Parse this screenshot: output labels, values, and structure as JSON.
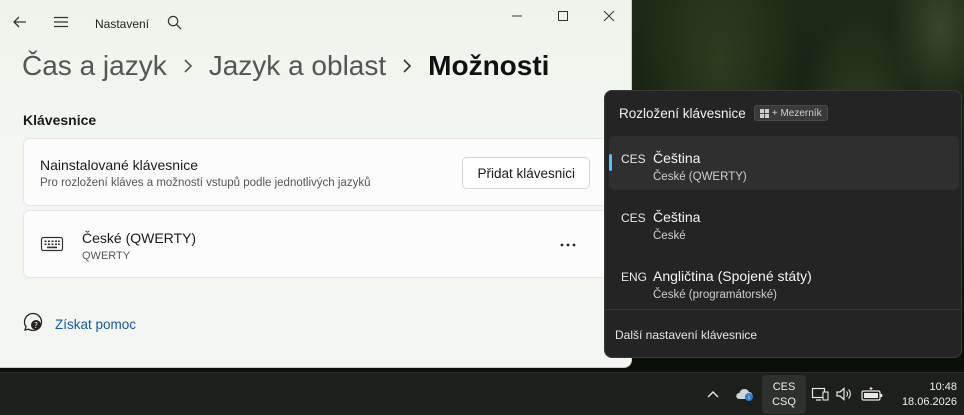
{
  "window": {
    "app_title": "Nastavení",
    "breadcrumb": [
      "Čas a jazyk",
      "Jazyk a oblast",
      "Možnosti"
    ]
  },
  "keyboards_section": {
    "title": "Klávesnice",
    "installed_title": "Nainstalované klávesnice",
    "installed_sub": "Pro rozložení kláves a možností vstupů podle jednotlivých jazyků",
    "add_button": "Přidat klávesnici",
    "keyboard_name": "České (QWERTY)",
    "keyboard_sub": "QWERTY"
  },
  "help": {
    "label": "Získat pomoc"
  },
  "flyout": {
    "title": "Rozložení klávesnice",
    "shortcut_label": "+ Mezerník",
    "layouts": [
      {
        "code": "CES",
        "name": "Čeština",
        "sub": "České (QWERTY)",
        "selected": true
      },
      {
        "code": "CES",
        "name": "Čeština",
        "sub": "České",
        "selected": false
      },
      {
        "code": "ENG",
        "name": "Angličtina (Spojené státy)",
        "sub": "České (programátorské)",
        "selected": false
      }
    ],
    "footer_link": "Další nastavení klávesnice"
  },
  "taskbar": {
    "ime_line1": "CES",
    "ime_line2": "CSQ",
    "time": "10:48",
    "date": "18.06.2026"
  },
  "colors": {
    "accent": "#4cc2ff",
    "link": "#1557a6"
  },
  "icons": {
    "back": "back-arrow-icon",
    "menu": "hamburger-menu-icon",
    "search": "search-icon",
    "keyboard": "keyboard-icon",
    "help": "help-icon",
    "windows": "windows-logo-icon"
  }
}
